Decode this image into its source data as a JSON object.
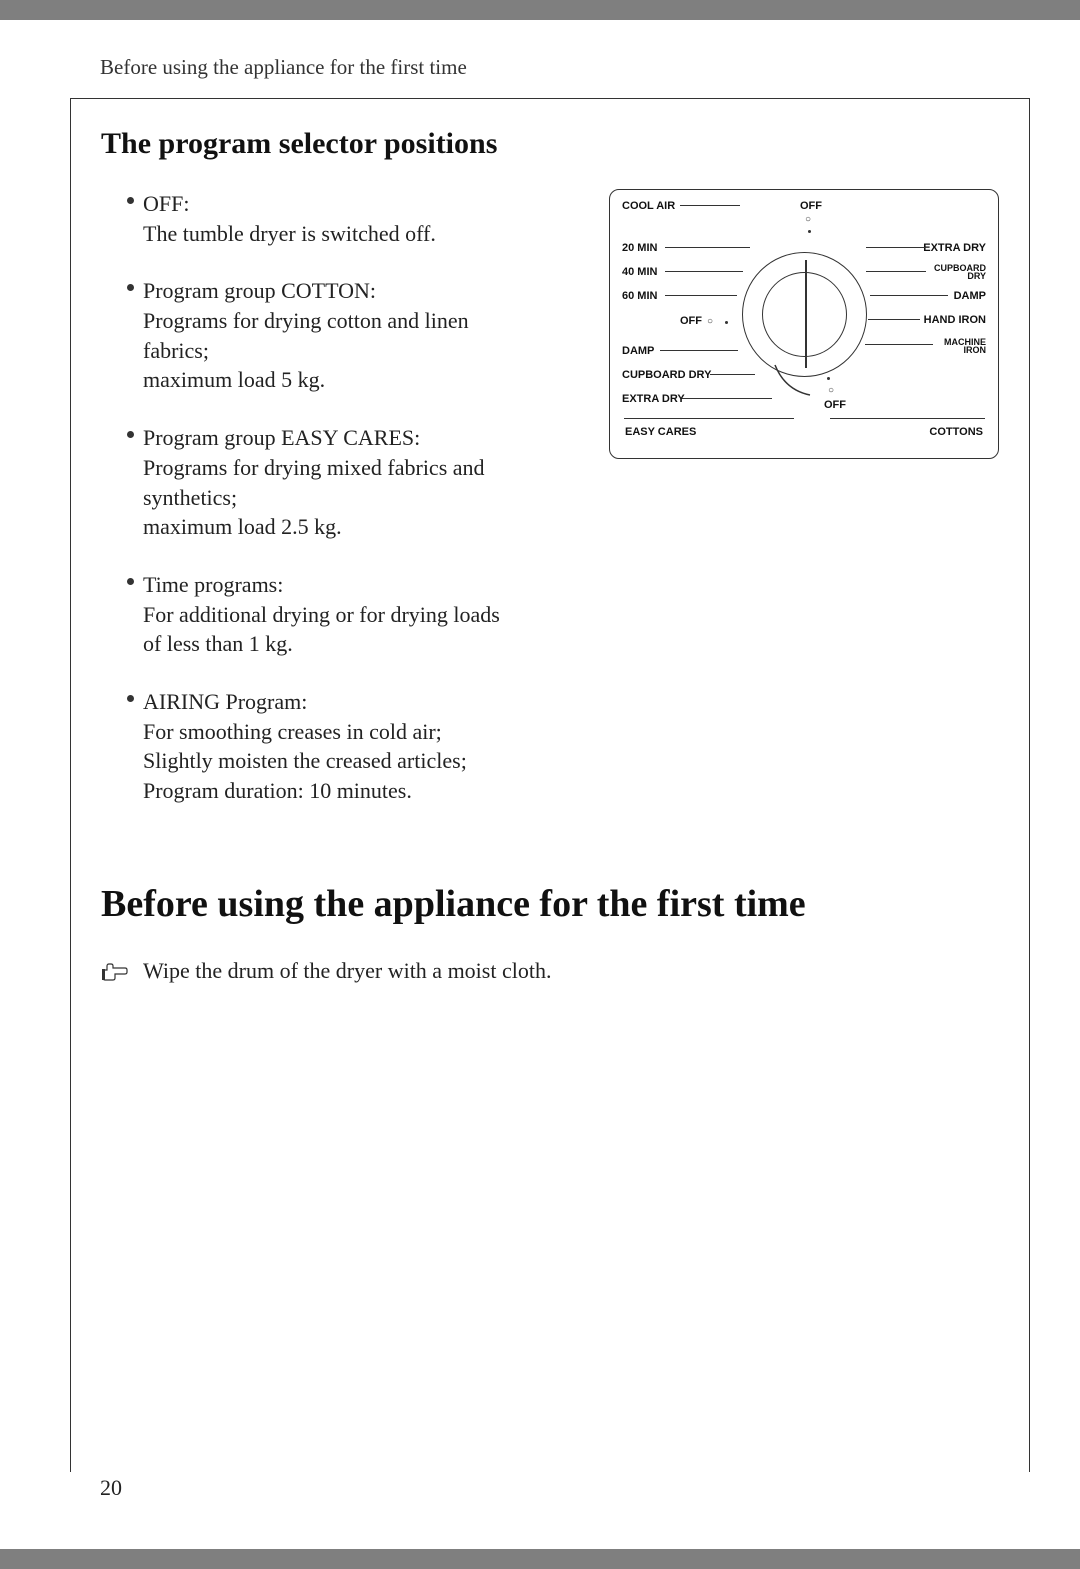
{
  "header": {
    "running_title": "Before using the appliance for the first time"
  },
  "subsection": {
    "title": "The program selector positions"
  },
  "bullets": [
    {
      "label": "OFF:",
      "body": "The tumble dryer is switched off."
    },
    {
      "label": "Program group COTTON:",
      "body": "Programs for drying cotton and linen fabrics;\nmaximum load 5 kg."
    },
    {
      "label": "Program group EASY CARES:",
      "body": "Programs for drying mixed fabrics and synthetics;\nmaximum load 2.5 kg."
    },
    {
      "label": "Time programs:",
      "body": "For additional drying or for drying loads of less than 1 kg."
    },
    {
      "label": "AIRING Program:",
      "body": "For smoothing creases in cold air; Slightly moisten the creased articles;\nProgram duration: 10 minutes."
    }
  ],
  "dial": {
    "top_left": "COOL AIR",
    "top_off": "OFF",
    "left_labels": [
      "20 MIN",
      "40 MIN",
      "60 MIN"
    ],
    "left_off": "OFF",
    "left_bottom": [
      "DAMP",
      "CUPBOARD DRY",
      "EXTRA DRY"
    ],
    "left_section": "EASY CARES",
    "right_labels": [
      "EXTRA DRY",
      "CUPBOARD DRY",
      "DAMP",
      "HAND IRON",
      "MACHINE IRON"
    ],
    "right_section": "COTTONS",
    "bottom_off": "OFF"
  },
  "section": {
    "title": "Before using the appliance for the first time",
    "instruction": "Wipe the drum of the dryer with a moist cloth."
  },
  "page_number": "20"
}
